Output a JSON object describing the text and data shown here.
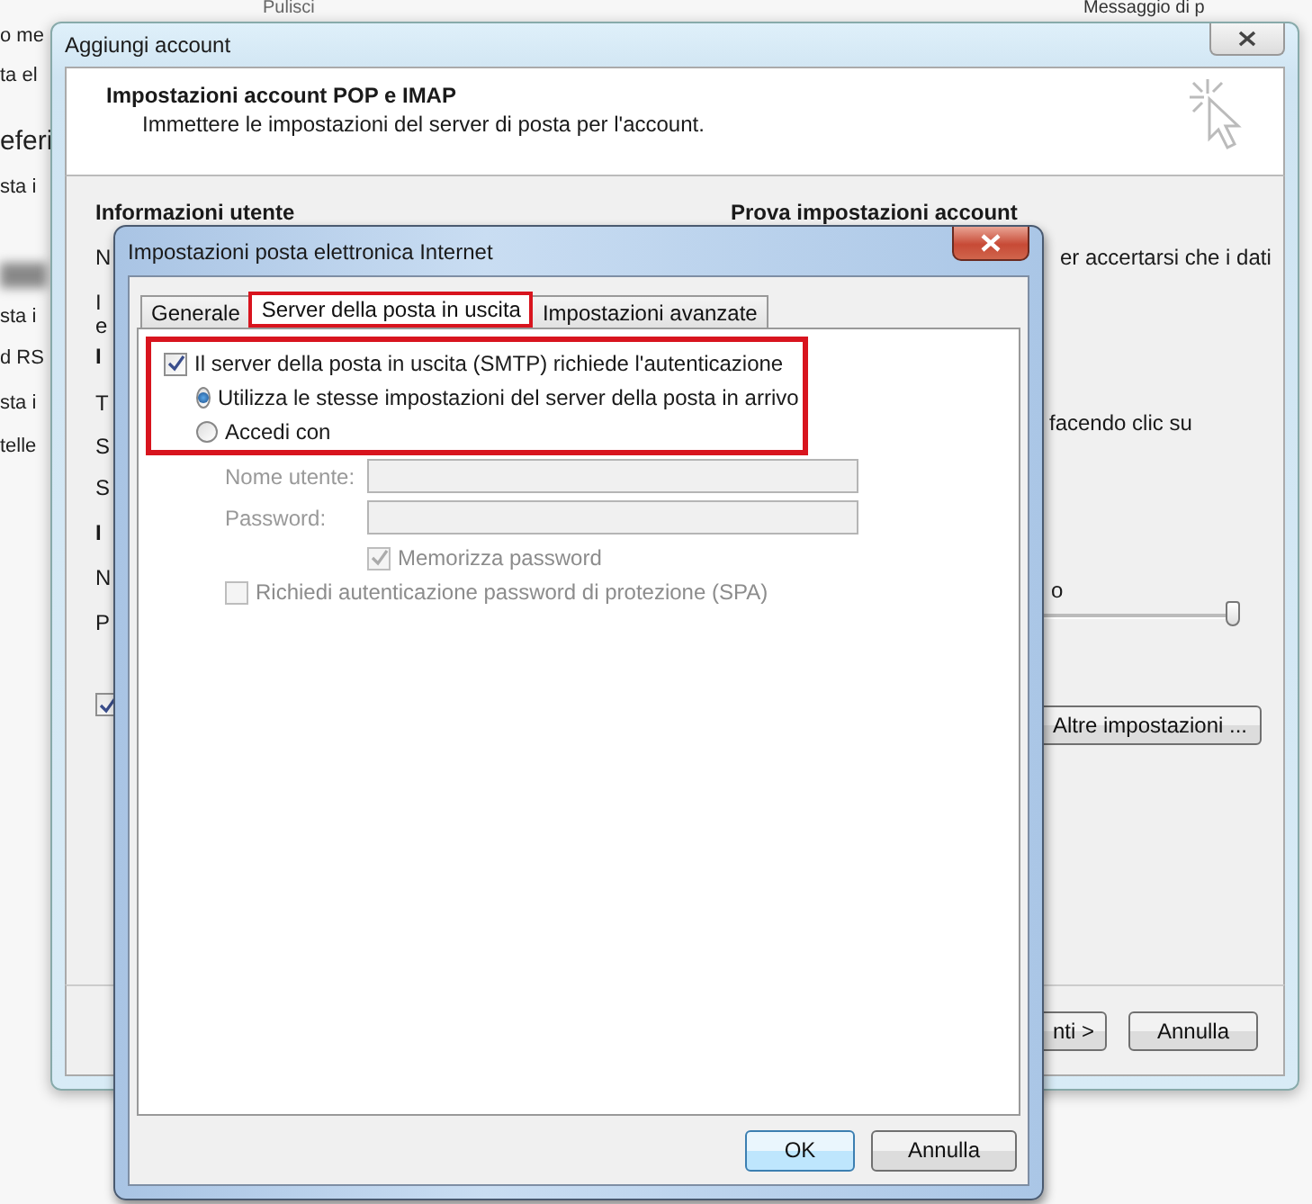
{
  "background_app": {
    "left_fragments": [
      {
        "text": "o me",
        "large": false
      },
      {
        "text": "ta el",
        "large": false
      },
      {
        "text": "eferi",
        "large": true
      },
      {
        "text": "sta i",
        "large": false
      },
      {
        "text": "sta i",
        "large": false
      },
      {
        "text": "d RS",
        "large": false
      },
      {
        "text": "sta i",
        "large": false
      },
      {
        "text": "telle",
        "large": false
      }
    ],
    "toolbar_fragments": [
      "Pulisci",
      "Messaggio di p"
    ]
  },
  "outer_dialog": {
    "title": "Aggiungi account",
    "heading": "Impostazioni account POP e IMAP",
    "subheading": "Immettere le impostazioni del server di posta per l'account.",
    "left_section": "Informazioni utente",
    "left_labels": [
      {
        "text": "N",
        "bold": false
      },
      {
        "text": "I",
        "bold": false
      },
      {
        "text": "e",
        "bold": false
      },
      {
        "text": "I",
        "bold": true
      },
      {
        "text": "T",
        "bold": false
      },
      {
        "text": "S",
        "bold": false
      },
      {
        "text": "S",
        "bold": false
      },
      {
        "text": "I",
        "bold": true
      },
      {
        "text": "N",
        "bold": false
      },
      {
        "text": "P",
        "bold": false
      }
    ],
    "right_section": "Prova impostazioni account",
    "right_texts": [
      "er accertarsi che i dati",
      "facendo clic su",
      "o"
    ],
    "slider": {
      "level": 1
    },
    "checkbox": {
      "checked": true
    },
    "more_button": "Altre impostazioni ...",
    "buttons": [
      "nti >",
      "Annulla"
    ]
  },
  "inner_dialog": {
    "title": "Impostazioni posta elettronica Internet",
    "tabs": [
      {
        "label": "Generale",
        "selected": false
      },
      {
        "label": "Server della posta in uscita",
        "selected": true
      },
      {
        "label": "Impostazioni avanzate",
        "selected": false
      }
    ],
    "auth_checkbox": {
      "label": "Il server della posta in uscita (SMTP) richiede l'autenticazione",
      "checked": true
    },
    "radios": [
      {
        "label": "Utilizza le stesse impostazioni del server della posta in arrivo",
        "selected": true
      },
      {
        "label": "Accedi con",
        "selected": false
      }
    ],
    "fields": [
      {
        "label": "Nome utente:"
      },
      {
        "label": "Password:"
      }
    ],
    "remember": {
      "label": "Memorizza password",
      "checked": true,
      "disabled": true
    },
    "spa": {
      "label": "Richiedi autenticazione password di protezione (SPA)",
      "checked": false,
      "disabled": true
    },
    "buttons": [
      {
        "label": "OK",
        "default": true
      },
      {
        "label": "Annulla",
        "default": false
      }
    ]
  }
}
